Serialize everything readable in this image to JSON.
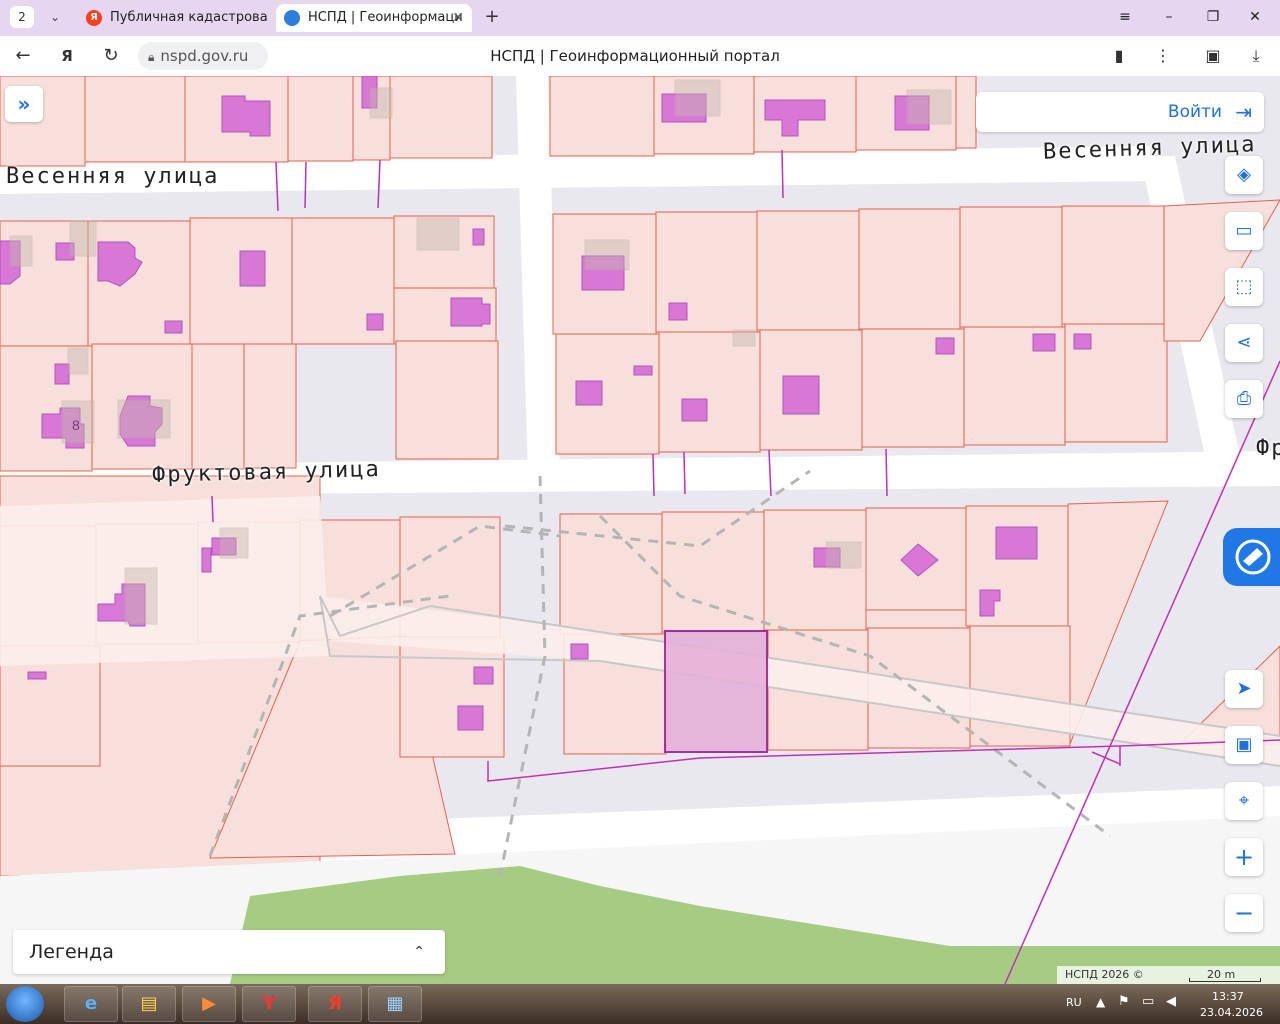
{
  "browser": {
    "tab_count": "2",
    "tabs": [
      {
        "title": "Публичная кадастровая к",
        "favicon": "Я",
        "active": false
      },
      {
        "title": "НСПД | Геоинформаци",
        "active": true
      }
    ],
    "url": "nspd.gov.ru",
    "page_title": "НСПД | Геоинформационный портал"
  },
  "map": {
    "streets": {
      "vesennyaya_left": "Весенняя улица",
      "vesennyaya_right": "Весенняя улица",
      "fruktovaya": "Фруктовая улица",
      "fruktovaya_right": "Фр"
    },
    "parcel_number": "8",
    "login_label": "Войти",
    "legend_label": "Легенда",
    "copyright": "НСПД 2026 ©",
    "scale_label": "20 m",
    "colors": {
      "parcel_fill": "#f7e0dc",
      "parcel_stroke": "#e8604a",
      "building": "#d66fd6",
      "selected": "#a020a0",
      "accent": "#1f6fe0"
    }
  },
  "controls": [
    "layers-icon",
    "ruler-icon",
    "select-area-icon",
    "share-icon",
    "print-icon",
    "locate-icon",
    "minimap-icon",
    "search-location-icon",
    "zoom-in-icon",
    "zoom-out-icon"
  ],
  "taskbar": {
    "lang": "RU",
    "time": "13:37",
    "date": "23.04.2026"
  }
}
